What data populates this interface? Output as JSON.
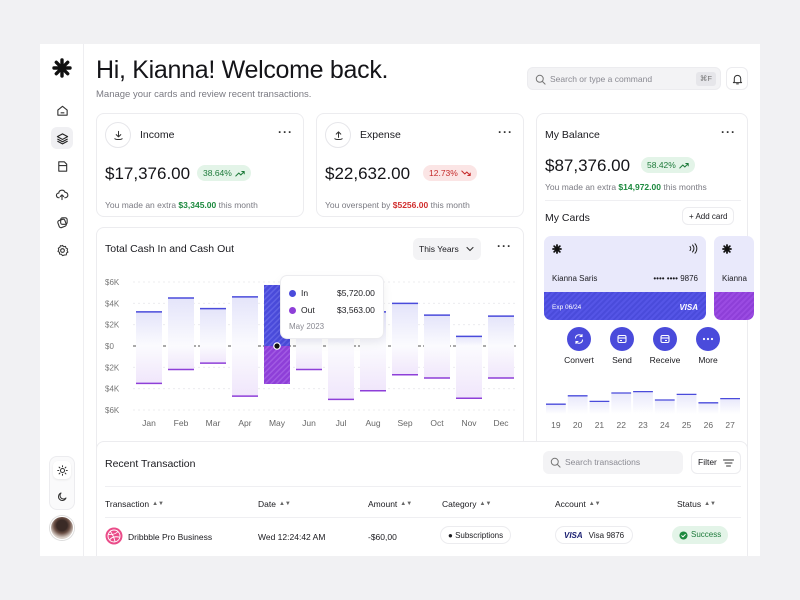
{
  "header": {
    "title": "Hi, Kianna! Welcome back.",
    "subtitle": "Manage your cards and review recent transactions.",
    "search_placeholder": "Search or type a command",
    "search_shortcut": "⌘F"
  },
  "sidebar": {
    "items": [
      {
        "icon": "home-icon"
      },
      {
        "icon": "layers-icon",
        "active": true
      },
      {
        "icon": "document-icon"
      },
      {
        "icon": "cloud-upload-icon"
      },
      {
        "icon": "cards-icon"
      },
      {
        "icon": "settings-icon"
      }
    ],
    "theme": {
      "light_icon": "sun-icon",
      "dark_icon": "moon-icon",
      "active": "light"
    }
  },
  "income": {
    "label": "Income",
    "amount": "$17,376.00",
    "change": "38.64%",
    "note_prefix": "You made an extra",
    "note_value": "$3,345.00",
    "note_suffix": "this month"
  },
  "expense": {
    "label": "Expense",
    "amount": "$22,632.00",
    "change": "12.73%",
    "note_prefix": "You overspent by",
    "note_value": "$5256.00",
    "note_suffix": "this month"
  },
  "balance": {
    "label": "My Balance",
    "amount": "$87,376.00",
    "change": "58.42%",
    "note_prefix": "You made an extra",
    "note_value": "$14,972.00",
    "note_suffix": "this months"
  },
  "cards": {
    "title": "My Cards",
    "add_label": "Add card",
    "primary": {
      "holder": "Kianna Saris",
      "number": "•••• •••• 9876",
      "exp": "Exp 06/24",
      "brand": "VISA"
    },
    "secondary": {
      "holder": "Kianna"
    },
    "actions": [
      {
        "label": "Convert",
        "icon": "convert-icon"
      },
      {
        "label": "Send",
        "icon": "send-icon"
      },
      {
        "label": "Receive",
        "icon": "receive-icon"
      },
      {
        "label": "More",
        "icon": "more-icon"
      }
    ],
    "mini_chart": {
      "days": [
        "19",
        "20",
        "21",
        "22",
        "23",
        "24",
        "25",
        "26",
        "27"
      ],
      "levels": [
        0.35,
        0.65,
        0.45,
        0.75,
        0.8,
        0.5,
        0.7,
        0.4,
        0.55
      ]
    }
  },
  "cashflow": {
    "title": "Total Cash In and Cash Out",
    "period": "This Years",
    "tooltip": {
      "in_label": "In",
      "in_value": "$5,720.00",
      "out_label": "Out",
      "out_value": "$3,563.00",
      "date": "May 2023"
    }
  },
  "chart_data": {
    "type": "bar",
    "title": "Total Cash In and Cash Out",
    "categories": [
      "Jan",
      "Feb",
      "Mar",
      "Apr",
      "May",
      "Jun",
      "Jul",
      "Aug",
      "Sep",
      "Oct",
      "Nov",
      "Dec"
    ],
    "series": [
      {
        "name": "In",
        "values": [
          3.2,
          4.5,
          3.5,
          4.6,
          5.72,
          2.0,
          1.9,
          3.2,
          4.0,
          2.9,
          0.9,
          2.8
        ]
      },
      {
        "name": "Out",
        "values": [
          -3.5,
          -2.2,
          -1.6,
          -4.7,
          -3.563,
          -2.2,
          -5.0,
          -4.2,
          -2.7,
          -3.0,
          -4.9,
          -3.0
        ]
      }
    ],
    "y_ticks": [
      "$6K",
      "$4K",
      "$2K",
      "$0",
      "$2K",
      "$4K",
      "$6K"
    ],
    "ylim": [
      -6,
      6
    ],
    "highlight": "May",
    "colors": {
      "in": "#4a4bdb",
      "out": "#8e3fd8"
    }
  },
  "transactions": {
    "title": "Recent Transaction",
    "search_placeholder": "Search transactions",
    "filter_label": "Filter",
    "columns": [
      "Transaction",
      "Date",
      "Amount",
      "Category",
      "Account",
      "Status"
    ],
    "rows": [
      {
        "name": "Dribbble Pro Business",
        "date": "Wed 12:24:42 AM",
        "amount": "-$60,00",
        "category": "Subscriptions",
        "account_brand": "VISA",
        "account": "Visa 9876",
        "status": "Success"
      }
    ]
  }
}
